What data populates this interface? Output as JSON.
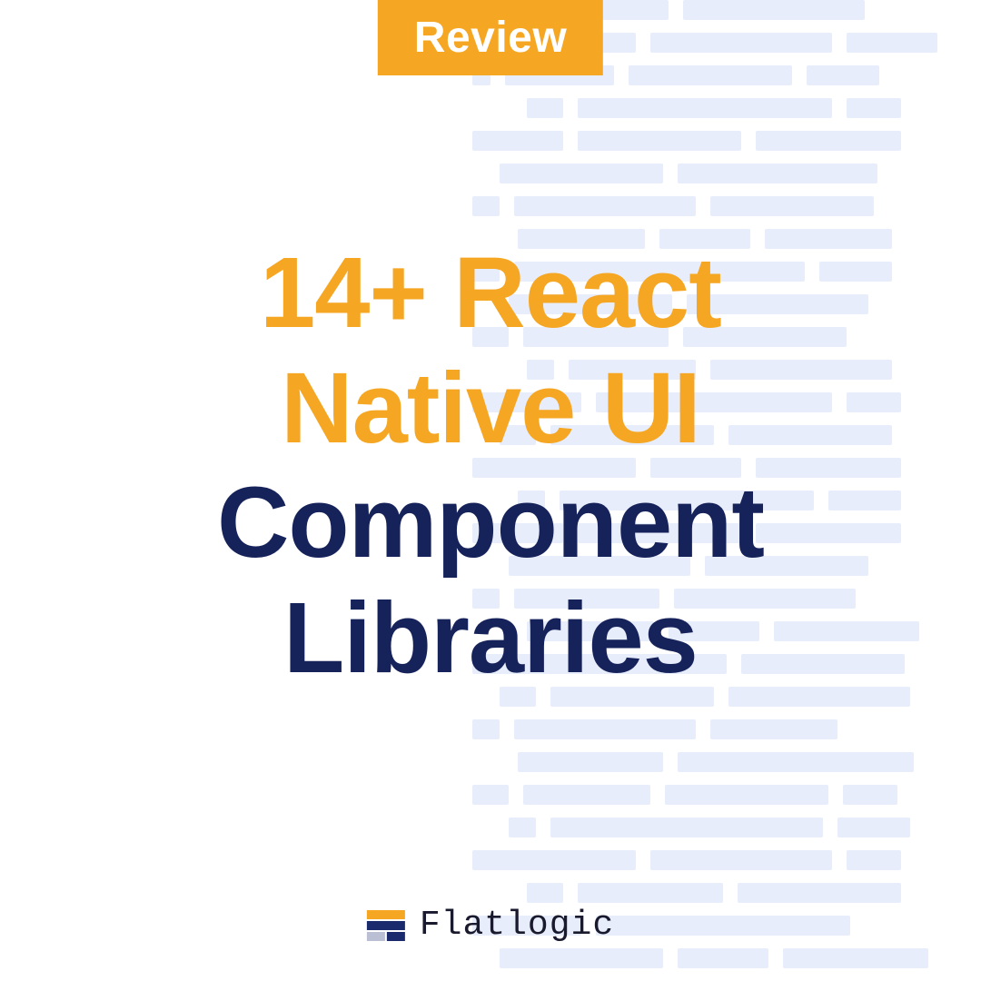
{
  "badge": {
    "label": "Review"
  },
  "title": {
    "line1": "14+ React",
    "line2": "Native UI",
    "line3": "Component",
    "line4": "Libraries"
  },
  "logo": {
    "name": "Flatlogic"
  },
  "colors": {
    "accent": "#f5a623",
    "navy": "#16225a",
    "bgBlock": "#e8edfb"
  }
}
